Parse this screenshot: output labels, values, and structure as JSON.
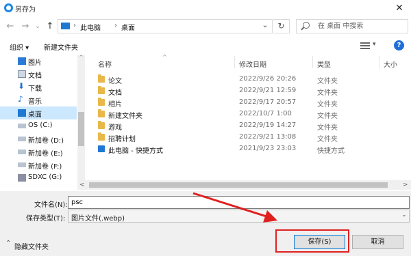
{
  "window": {
    "title": "另存为",
    "close_glyph": "✕"
  },
  "nav": {
    "back_glyph": "←",
    "forward_glyph": "→",
    "history_glyph": "⌄",
    "up_glyph": "↑"
  },
  "address": {
    "crumbs": [
      "此电脑",
      "桌面"
    ],
    "separator": "›",
    "dropdown_glyph": "⌄",
    "refresh_glyph": "↻"
  },
  "search": {
    "placeholder": "在 桌面 中搜索"
  },
  "toolbar": {
    "organize_label": "组织 ▾",
    "new_folder_label": "新建文件夹",
    "view_dd_glyph": "▾",
    "help_glyph": "?"
  },
  "sidebar": {
    "items": [
      {
        "label": "图片",
        "icon": "pictures-icon"
      },
      {
        "label": "文档",
        "icon": "documents-icon"
      },
      {
        "label": "下载",
        "icon": "download-icon"
      },
      {
        "label": "音乐",
        "icon": "music-icon"
      },
      {
        "label": "桌面",
        "icon": "desktop-icon",
        "selected": true
      },
      {
        "label": "OS (C:)",
        "icon": "drive-icon"
      },
      {
        "label": "新加卷 (D:)",
        "icon": "drive-icon"
      },
      {
        "label": "新加卷 (E:)",
        "icon": "drive-icon"
      },
      {
        "label": "新加卷 (F:)",
        "icon": "drive-icon"
      },
      {
        "label": "SDXC (G:)",
        "icon": "sd-card-icon"
      }
    ]
  },
  "columns": {
    "name": "名称",
    "date": "修改日期",
    "type": "类型",
    "size": "大小",
    "sort_glyph": "^"
  },
  "files": [
    {
      "name": "论文",
      "date": "2022/9/26 20:26",
      "type": "文件夹",
      "icon": "folder-icon"
    },
    {
      "name": "文档",
      "date": "2022/9/21 12:59",
      "type": "文件夹",
      "icon": "folder-icon"
    },
    {
      "name": "相片",
      "date": "2022/9/17 20:57",
      "type": "文件夹",
      "icon": "folder-icon"
    },
    {
      "name": "新建文件夹",
      "date": "2022/10/7 1:00",
      "type": "文件夹",
      "icon": "folder-icon"
    },
    {
      "name": "游戏",
      "date": "2022/9/19 14:27",
      "type": "文件夹",
      "icon": "folder-icon"
    },
    {
      "name": "招聘计划",
      "date": "2022/9/21 13:08",
      "type": "文件夹",
      "icon": "folder-icon"
    },
    {
      "name": "此电脑 - 快捷方式",
      "date": "2021/9/23 23:03",
      "type": "快捷方式",
      "icon": "shortcut-icon"
    }
  ],
  "scroll": {
    "left_glyph": "<",
    "right_glyph": ">",
    "up_glyph": "^",
    "down_glyph": "v"
  },
  "form": {
    "filename_label": "文件名(N):",
    "filename_value": "psc",
    "filetype_label": "保存类型(T):",
    "filetype_value": "图片文件(.webp)",
    "dropdown_glyph": "⌄"
  },
  "footer": {
    "hide_folders_label": "隐藏文件夹",
    "hide_caret": "⌃",
    "save_label": "保存(S)",
    "cancel_label": "取消"
  },
  "colors": {
    "accent": "#0078d7",
    "annotation": "#e0201f",
    "selected_bg": "#cce8ff"
  }
}
